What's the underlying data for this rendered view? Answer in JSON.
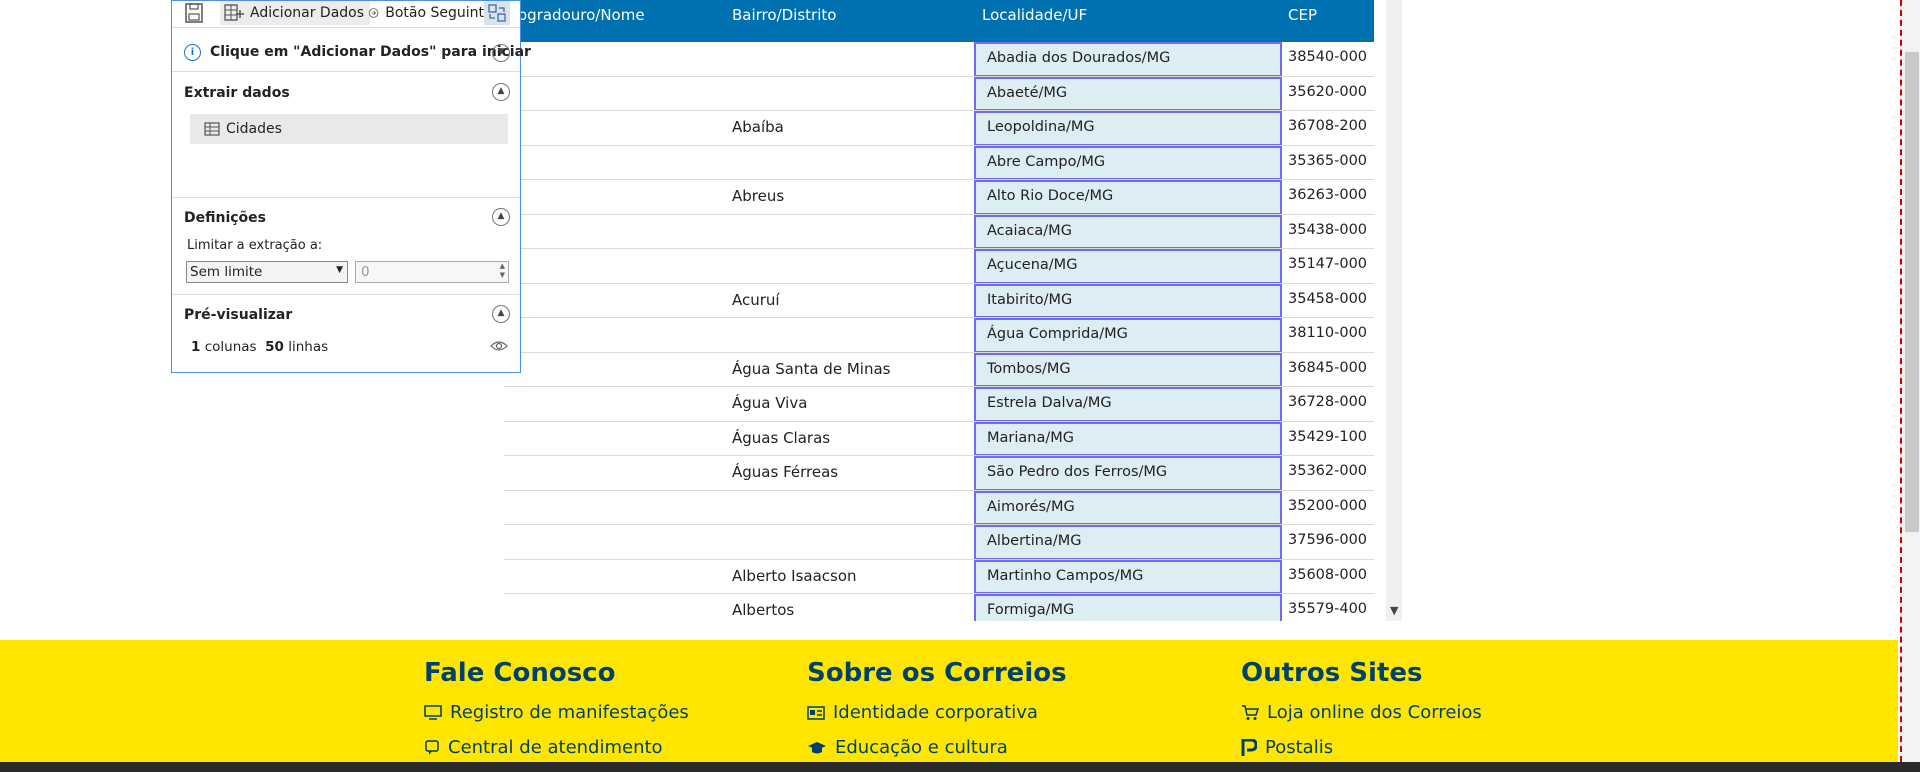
{
  "toolbar": {
    "add_data_label": "Adicionar Dados",
    "next_button_label": "Botão Seguint"
  },
  "info": {
    "text": "Clique em \"Adicionar Dados\" para iniciar"
  },
  "extract": {
    "title": "Extrair dados",
    "item_label": "Cidades"
  },
  "settings": {
    "title": "Definições",
    "limit_label": "Limitar a extração a:",
    "limit_select_value": "Sem limite",
    "limit_number_value": "0"
  },
  "preview": {
    "title": "Pré-visualizar",
    "columns_count": "1",
    "columns_label": "colunas",
    "rows_count": "50",
    "rows_label": "linhas"
  },
  "table": {
    "headers": {
      "logradouro": "ogradouro/Nome",
      "bairro": "Bairro/Distrito",
      "localidade": "Localidade/UF",
      "cep": "CEP"
    },
    "rows": [
      {
        "bairro": "",
        "localidade": "Abadia dos Dourados/MG",
        "cep": "38540-000"
      },
      {
        "bairro": "",
        "localidade": "Abaeté/MG",
        "cep": "35620-000"
      },
      {
        "bairro": "Abaíba",
        "localidade": "Leopoldina/MG",
        "cep": "36708-200"
      },
      {
        "bairro": "",
        "localidade": "Abre Campo/MG",
        "cep": "35365-000"
      },
      {
        "bairro": "Abreus",
        "localidade": "Alto Rio Doce/MG",
        "cep": "36263-000"
      },
      {
        "bairro": "",
        "localidade": "Acaiaca/MG",
        "cep": "35438-000"
      },
      {
        "bairro": "",
        "localidade": "Açucena/MG",
        "cep": "35147-000"
      },
      {
        "bairro": "Acuruí",
        "localidade": "Itabirito/MG",
        "cep": "35458-000"
      },
      {
        "bairro": "",
        "localidade": "Água Comprida/MG",
        "cep": "38110-000"
      },
      {
        "bairro": "Água Santa de Minas",
        "localidade": "Tombos/MG",
        "cep": "36845-000"
      },
      {
        "bairro": "Água Viva",
        "localidade": "Estrela Dalva/MG",
        "cep": "36728-000"
      },
      {
        "bairro": "Águas Claras",
        "localidade": "Mariana/MG",
        "cep": "35429-100"
      },
      {
        "bairro": "Águas Férreas",
        "localidade": "São Pedro dos Ferros/MG",
        "cep": "35362-000"
      },
      {
        "bairro": "",
        "localidade": "Aimorés/MG",
        "cep": "35200-000"
      },
      {
        "bairro": "",
        "localidade": "Albertina/MG",
        "cep": "37596-000"
      },
      {
        "bairro": "Alberto Isaacson",
        "localidade": "Martinho Campos/MG",
        "cep": "35608-000"
      },
      {
        "bairro": "Albertos",
        "localidade": "Formiga/MG",
        "cep": "35579-400"
      }
    ]
  },
  "footer": {
    "col1": {
      "title": "Fale Conosco",
      "links": [
        "Registro de manifestações",
        "Central de atendimento"
      ]
    },
    "col2": {
      "title": "Sobre os Correios",
      "links": [
        "Identidade corporativa",
        "Educação e cultura"
      ]
    },
    "col3": {
      "title": "Outros Sites",
      "links": [
        "Loja online dos Correios",
        "Postalis"
      ]
    }
  },
  "colors": {
    "header_blue": "#0071b0",
    "selection_border": "#6f6cf0",
    "selection_fill": "#dcedf3",
    "footer_yellow": "#ffe600",
    "footer_text": "#00416b"
  }
}
